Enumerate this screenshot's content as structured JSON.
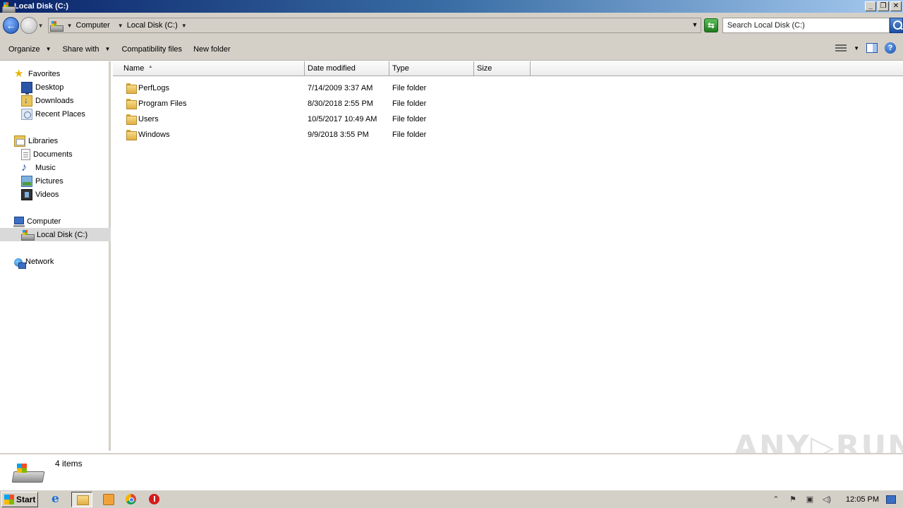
{
  "window": {
    "title": "Local Disk (C:)",
    "buttons": [
      "_",
      "❐",
      "✕"
    ]
  },
  "address": {
    "crumbs": [
      "Computer",
      "Local Disk (C:)"
    ],
    "search_placeholder": "Search Local Disk (C:)"
  },
  "toolbar": {
    "organize": "Organize",
    "share_with": "Share with",
    "compatibility": "Compatibility files",
    "new_folder": "New folder"
  },
  "nav": {
    "favorites": "Favorites",
    "desktop": "Desktop",
    "downloads": "Downloads",
    "recent": "Recent Places",
    "libraries": "Libraries",
    "documents": "Documents",
    "music": "Music",
    "pictures": "Pictures",
    "videos": "Videos",
    "computer": "Computer",
    "local_disk": "Local Disk (C:)",
    "network": "Network"
  },
  "columns": {
    "name": "Name",
    "date": "Date modified",
    "type": "Type",
    "size": "Size"
  },
  "files": [
    {
      "name": "PerfLogs",
      "date": "7/14/2009 3:37 AM",
      "type": "File folder"
    },
    {
      "name": "Program Files",
      "date": "8/30/2018 2:55 PM",
      "type": "File folder"
    },
    {
      "name": "Users",
      "date": "10/5/2017 10:49 AM",
      "type": "File folder"
    },
    {
      "name": "Windows",
      "date": "9/9/2018 3:55 PM",
      "type": "File folder"
    }
  ],
  "status": {
    "count": "4 items"
  },
  "watermark": "ANY▷RUN",
  "taskbar": {
    "start": "Start",
    "clock": "12:05 PM"
  }
}
